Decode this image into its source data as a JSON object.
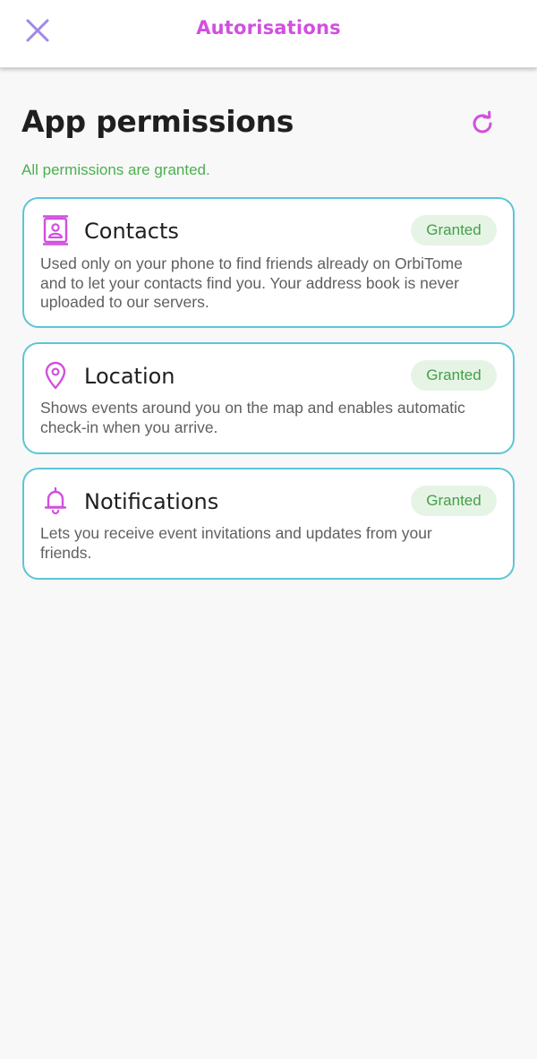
{
  "header": {
    "title": "Autorisations",
    "close_icon": "close-icon",
    "accent_color": "#d24fe0"
  },
  "main": {
    "heading": "App permissions",
    "refresh_icon": "refresh-icon",
    "status": "All permissions are granted.",
    "status_color": "#4caf50",
    "permissions": [
      {
        "icon": "contacts-icon",
        "title": "Contacts",
        "status": "Granted",
        "description": "Used only on your phone to find friends already on OrbiTome and to let your contacts find you. Your address book is never uploaded to our servers."
      },
      {
        "icon": "location-pin-icon",
        "title": "Location",
        "status": "Granted",
        "description": "Shows events around you on the map and enables automatic check-in when you arrive."
      },
      {
        "icon": "bell-icon",
        "title": "Notifications",
        "status": "Granted",
        "description": "Lets you receive event invitations and updates from your friends."
      }
    ]
  }
}
